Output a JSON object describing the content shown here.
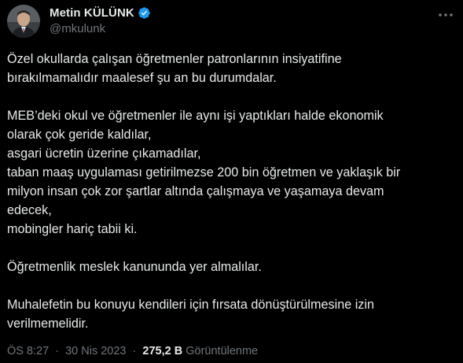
{
  "author": {
    "display_name": "Metin KÜLÜNK",
    "handle": "@mkulunk",
    "verified": true
  },
  "tweet": {
    "paragraphs": [
      [
        "Özel okullarda çalışan öğretmenler  patronlarının insiyatifine",
        "bırakılmamalıdır maalesef şu an bu durumdalar."
      ],
      [
        "MEB’deki okul ve öğretmenler ile aynı işi yaptıkları  halde ekonomik",
        "olarak çok geride kaldılar,",
        "asgari ücretin üzerine çıkamadılar,",
        "taban maaş uygulaması getirilmezse 200 bin öğretmen ve yaklaşık bir",
        "milyon insan çok zor şartlar altında çalışmaya ve yaşamaya devam",
        "edecek,",
        "mobingler hariç tabii ki."
      ],
      [
        "Öğretmenlik meslek kanununda yer almalılar."
      ],
      [
        "Muhalefetin  bu konuyu kendileri için fırsata dönüştürülmesine izin",
        "verilmemelidir."
      ]
    ]
  },
  "meta": {
    "time": "ÖS 8:27",
    "separator": "·",
    "date": "30 Nis 2023",
    "views_count": "275,2 B",
    "views_label": "Görüntülenme"
  },
  "icons": {
    "verified": "verified-badge-icon",
    "more": "more-options-icon"
  },
  "colors": {
    "background": "#000000",
    "text": "#e7e9ea",
    "secondary": "#71767b",
    "verified_blue": "#1d9bf0"
  }
}
